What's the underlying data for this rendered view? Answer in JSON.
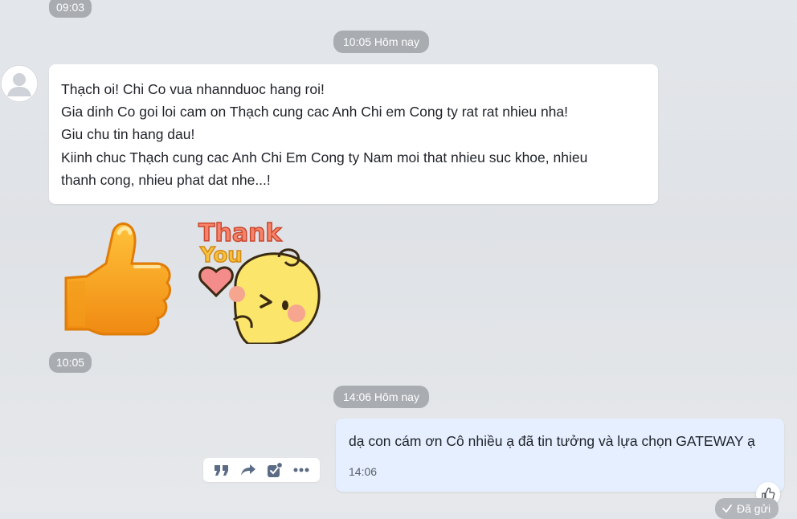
{
  "chat": {
    "top_time": "09:03",
    "separator_1": "10:05 Hôm nay",
    "incoming_message": {
      "lines": [
        "Thạch oi! Chi Co vua nhannduoc hang roi!",
        "Gia dinh Co goi loi cam on Thạch cung cac Anh Chi em Cong ty rat rat nhieu nha!",
        "Giu chu tin hang dau!",
        "Kiinh chuc Thạch cung cac Anh Chi Em Cong ty Nam moi that nhieu suc khoe, nhieu",
        "thanh cong, nhieu phat dat nhe...!"
      ]
    },
    "sticker_thank_text": [
      "Thank",
      "You"
    ],
    "sticker_time": "10:05",
    "separator_2": "14:06 Hôm nay",
    "outgoing_message": {
      "text": "dạ con cám ơn Cô nhiều ạ đã tin tưởng và lựa chọn GATEWAY ạ",
      "time": "14:06",
      "status": "Đã gửi"
    }
  },
  "icons": {
    "avatar": "default-user-avatar-icon",
    "quote": "quote-icon",
    "forward": "forward-icon",
    "task": "task-check-icon",
    "more": "more-dots-icon",
    "like": "thumbs-up-icon",
    "status": "check-icon"
  },
  "colors": {
    "outgoing_bubble": "#e5efff",
    "incoming_bubble": "#ffffff",
    "pill": "#a9acb1"
  }
}
